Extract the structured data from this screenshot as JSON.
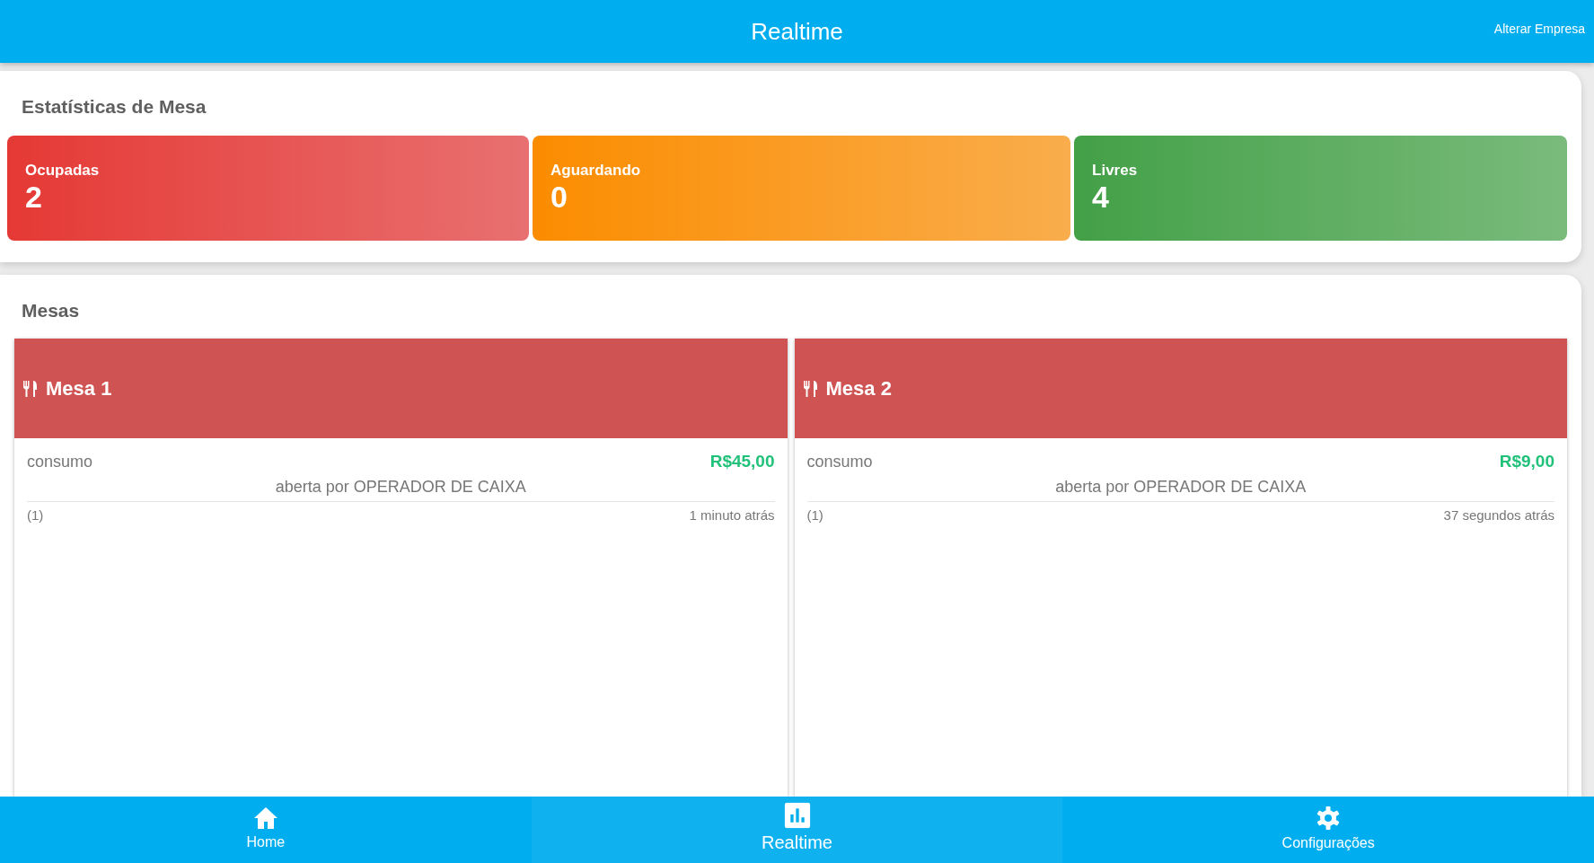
{
  "header": {
    "title": "Realtime",
    "action": "Alterar Empresa"
  },
  "statistics": {
    "title": "Estatísticas de Mesa",
    "cards": [
      {
        "kind": "occupied",
        "label": "Ocupadas",
        "value": "2"
      },
      {
        "kind": "waiting",
        "label": "Aguardando",
        "value": "0"
      },
      {
        "kind": "free",
        "label": "Livres",
        "value": "4"
      }
    ]
  },
  "tables": {
    "title": "Mesas",
    "items": [
      {
        "kind": "occupied",
        "name": "Mesa 1",
        "consumption_label": "consumo",
        "amount": "R$45,00",
        "opened_by": "aberta por OPERADOR DE CAIXA",
        "count": "(1)",
        "time": "1 minuto atrás"
      },
      {
        "kind": "occupied",
        "name": "Mesa 2",
        "consumption_label": "consumo",
        "amount": "R$9,00",
        "opened_by": "aberta por OPERADOR DE CAIXA",
        "count": "(1)",
        "time": "37 segundos atrás"
      }
    ]
  },
  "bottom_nav": [
    {
      "kind": "home",
      "label": "Home",
      "selected": false
    },
    {
      "kind": "chart",
      "label": "Realtime",
      "selected": true
    },
    {
      "kind": "settings",
      "label": "Configurações",
      "selected": false
    }
  ]
}
